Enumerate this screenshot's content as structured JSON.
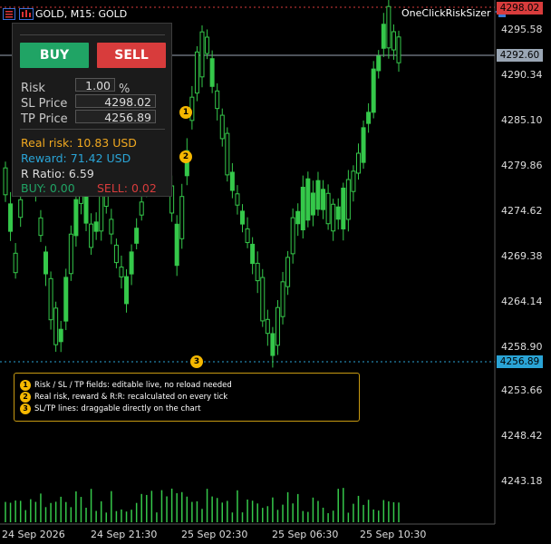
{
  "symbol_bar": {
    "title": "GOLD, M15:  GOLD"
  },
  "brand": {
    "name": "OneClickRiskSizer",
    "icon": "graduation-cap-icon"
  },
  "price_axis": [
    "4295.58",
    "4290.34",
    "4285.10",
    "4279.86",
    "4274.62",
    "4269.38",
    "4264.14",
    "4258.90",
    "4253.66",
    "4248.42",
    "4243.18"
  ],
  "price_tags": {
    "top": "4298.02",
    "current": "4292.60",
    "tp": "4256.89"
  },
  "time_axis": [
    "24 Sep 2026",
    "24 Sep 21:30",
    "25 Sep 02:30",
    "25 Sep 06:30",
    "25 Sep 10:30"
  ],
  "panel": {
    "buy_label": "BUY",
    "sell_label": "SELL",
    "risk_label": "Risk",
    "risk_value": "1.00",
    "risk_unit": "%",
    "sl_label": "SL Price",
    "sl_value": "4298.02",
    "tp_label": "TP Price",
    "tp_value": "4256.89",
    "real_risk": "Real risk: 10.83 USD",
    "reward": "Reward: 71.42 USD",
    "ratio": "R Ratio: 6.59",
    "buy_lots": "BUY: 0.00",
    "sell_lots": "SELL: 0.02"
  },
  "badges": [
    "1",
    "2",
    "3"
  ],
  "notes": [
    "Risk / SL / TP fields: editable live, no reload needed",
    "Real risk, reward & R:R: recalculated on every tick",
    "SL/TP lines: draggable directly on the chart"
  ],
  "colors": {
    "bull": "#35c84a",
    "bear": "#ffffff",
    "sl_line": "#d83c3c",
    "tp_line": "#2aa4d6",
    "accent_badge": "#f5b800",
    "real_risk": "#f0a820",
    "reward": "#2aa4d6",
    "buy_green": "#20a465",
    "sell_red": "#d83c3c"
  }
}
